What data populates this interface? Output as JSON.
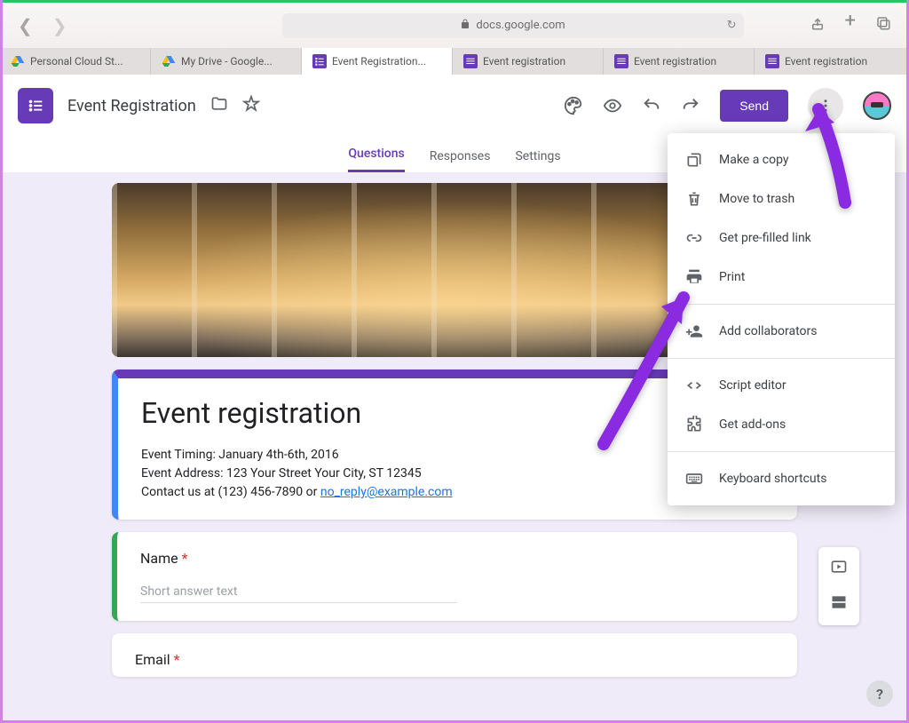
{
  "browser": {
    "address": "docs.google.com",
    "tabs": [
      {
        "title": "Personal Cloud St...",
        "favicon": "drive"
      },
      {
        "title": "My Drive - Google...",
        "favicon": "drive"
      },
      {
        "title": "Event Registration...",
        "favicon": "forms",
        "active": true
      },
      {
        "title": "Event registration",
        "favicon": "forms"
      },
      {
        "title": "Event registration",
        "favicon": "forms"
      },
      {
        "title": "Event registration",
        "favicon": "forms"
      }
    ]
  },
  "header": {
    "doc_title": "Event Registration",
    "send_label": "Send"
  },
  "form_tabs": [
    "Questions",
    "Responses",
    "Settings"
  ],
  "form": {
    "title": "Event registration",
    "desc_lines": [
      "Event Timing: January 4th-6th, 2016",
      "Event Address: 123 Your Street Your City, ST 12345"
    ],
    "contact_prefix": "Contact us at (123) 456-7890 or ",
    "contact_email": "no_reply@example.com",
    "q1_label": "Name",
    "q1_placeholder": "Short answer text",
    "q2_label": "Email"
  },
  "menu": {
    "groups": [
      [
        {
          "icon": "copy",
          "label": "Make a copy"
        },
        {
          "icon": "trash",
          "label": "Move to trash"
        },
        {
          "icon": "link",
          "label": "Get pre-filled link"
        },
        {
          "icon": "print",
          "label": "Print"
        }
      ],
      [
        {
          "icon": "person-add",
          "label": "Add collaborators"
        }
      ],
      [
        {
          "icon": "code",
          "label": "Script editor"
        },
        {
          "icon": "addon",
          "label": "Get add-ons"
        }
      ],
      [
        {
          "icon": "keyboard",
          "label": "Keyboard shortcuts"
        }
      ]
    ]
  },
  "colors": {
    "accent": "#673ab7",
    "annotation": "#8a2be2"
  }
}
